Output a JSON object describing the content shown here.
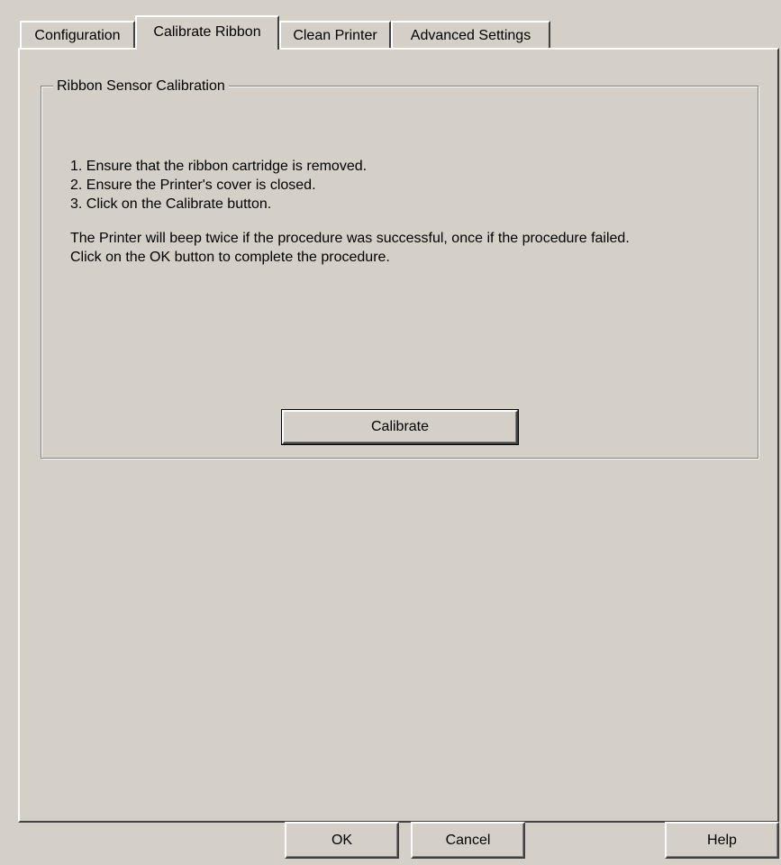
{
  "tabs": [
    {
      "label": "Configuration",
      "active": false
    },
    {
      "label": "Calibrate Ribbon",
      "active": true
    },
    {
      "label": "Clean Printer",
      "active": false
    },
    {
      "label": "Advanced Settings",
      "active": false
    }
  ],
  "group": {
    "title": "Ribbon Sensor Calibration",
    "steps": [
      "1. Ensure that the ribbon cartridge is removed.",
      "2. Ensure the Printer's cover is closed.",
      "3. Click on the Calibrate button."
    ],
    "notes": [
      "The Printer will beep twice if the procedure was successful, once if the procedure failed.",
      "Click on the OK button to complete the procedure."
    ],
    "calibrate_label": "Calibrate"
  },
  "footer": {
    "ok_label": "OK",
    "cancel_label": "Cancel",
    "help_label": "Help"
  }
}
